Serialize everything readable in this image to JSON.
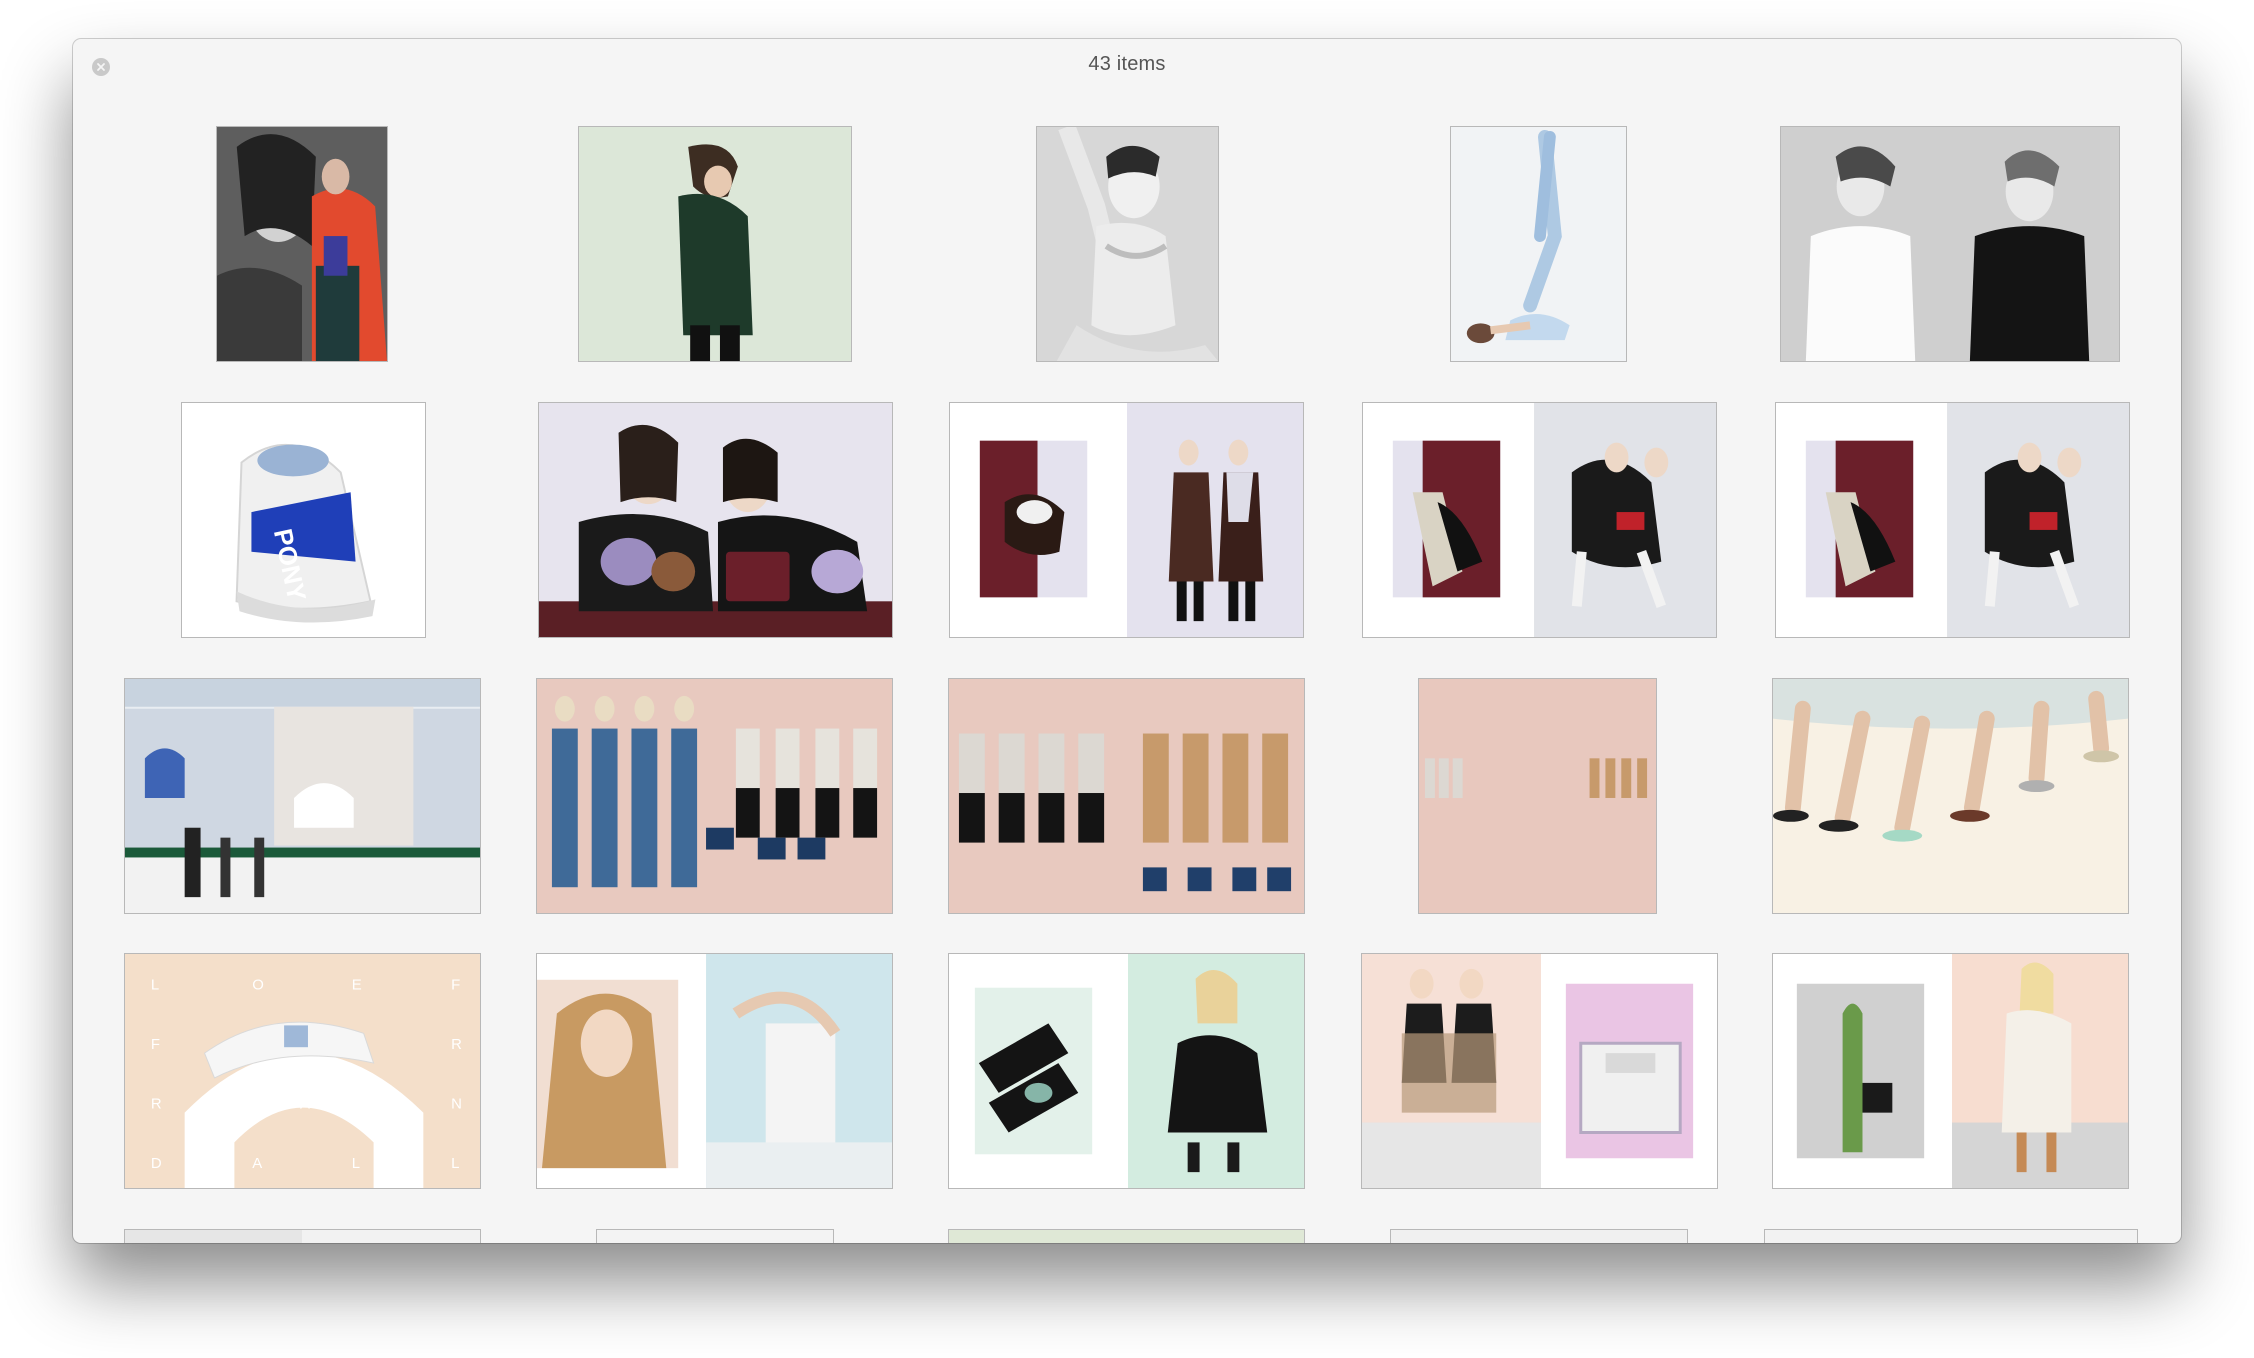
{
  "window": {
    "title": "43 items",
    "close_icon": "close-icon"
  },
  "colors": {
    "window_bg": "#f5f5f5",
    "thumb_border": "#b8b8b8",
    "close_bg": "#c9c9c9"
  },
  "items_icon": "image-thumbnail"
}
